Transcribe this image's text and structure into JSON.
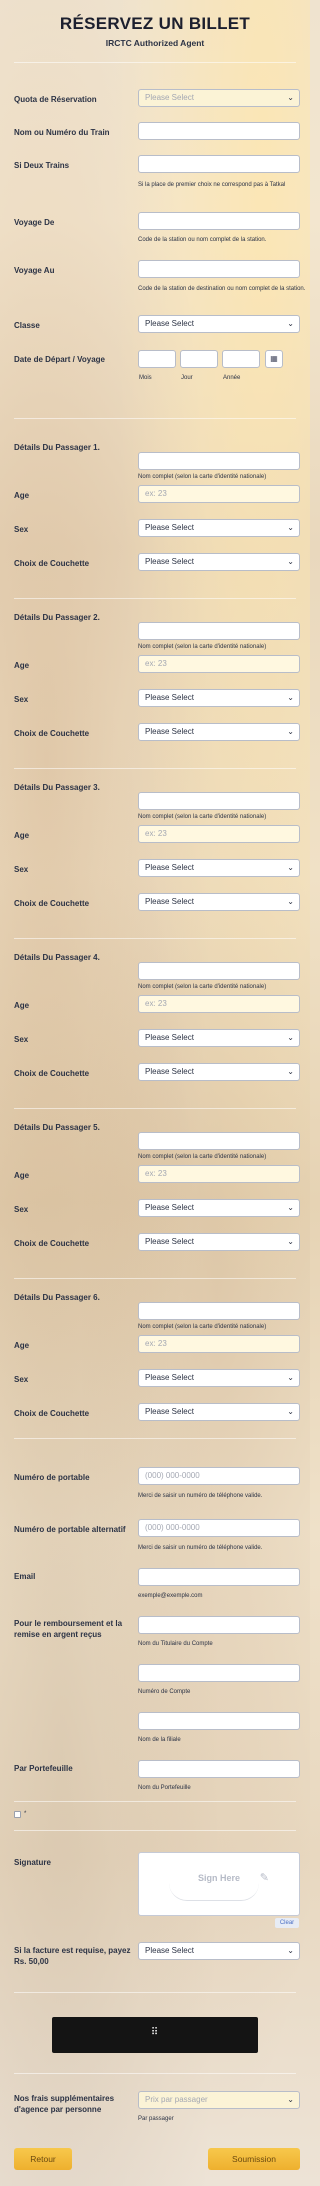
{
  "header": {
    "title": "RÉSERVEZ UN BILLET",
    "subtitle": "IRCTC Authorized Agent"
  },
  "fields": {
    "quota": {
      "label": "Quota de Réservation",
      "value": "Please Select"
    },
    "train": {
      "label": "Nom ou Numéro du Train"
    },
    "two_trains": {
      "label": "Si Deux Trains",
      "hint": "Si la place de premier choix ne correspond pas à Tatkal"
    },
    "from": {
      "label": "Voyage De",
      "hint": "Code de la station ou nom complet de la station."
    },
    "to": {
      "label": "Voyage Au",
      "hint": "Code de la station de destination ou nom complet de la station."
    },
    "class": {
      "label": "Classe",
      "value": "Please Select"
    },
    "date": {
      "label": "Date de Départ / Voyage",
      "month": "Mois",
      "day": "Jour",
      "year": "Année"
    }
  },
  "passengers": [
    {
      "title": "Détails Du Passager 1.",
      "name_hint": "Nom complet (selon la carte d'identité nationale)",
      "age_label": "Age",
      "age_ph": "ex: 23",
      "sex_label": "Sex",
      "sex_value": "Please Select",
      "berth_label": "Choix de Couchette",
      "berth_value": "Please Select"
    },
    {
      "title": "Détails Du Passager 2.",
      "name_hint": "Nom complet (selon la carte d'identité nationale)",
      "age_label": "Age",
      "age_ph": "ex: 23",
      "sex_label": "Sex",
      "sex_value": "Please Select",
      "berth_label": "Choix de Couchette",
      "berth_value": "Please Select"
    },
    {
      "title": "Détails Du Passager 3.",
      "name_hint": "Nom complet (selon la carte d'identité nationale)",
      "age_label": "Age",
      "age_ph": "ex: 23",
      "sex_label": "Sex",
      "sex_value": "Please Select",
      "berth_label": "Choix de Couchette",
      "berth_value": "Please Select"
    },
    {
      "title": "Détails Du Passager 4.",
      "name_hint": "Nom complet (selon la carte d'identité nationale)",
      "age_label": "Age",
      "age_ph": "ex: 23",
      "sex_label": "Sex",
      "sex_value": "Please Select",
      "berth_label": "Choix de Couchette",
      "berth_value": "Please Select"
    },
    {
      "title": "Détails Du Passager 5.",
      "name_hint": "Nom complet (selon la carte d'identité nationale)",
      "age_label": "Age",
      "age_ph": "ex: 23",
      "sex_label": "Sex",
      "sex_value": "Please Select",
      "berth_label": "Choix de Couchette",
      "berth_value": "Please Select"
    },
    {
      "title": "Détails Du Passager 6.",
      "name_hint": "Nom complet (selon la carte d'identité nationale)",
      "age_label": "Age",
      "age_ph": "ex: 23",
      "sex_label": "Sex",
      "sex_value": "Please Select",
      "berth_label": "Choix de Couchette",
      "berth_value": "Please Select"
    }
  ],
  "contact": {
    "mobile": {
      "label": "Numéro de portable",
      "placeholder": "(000) 000-0000",
      "hint": "Merci de saisir un numéro de téléphone valide."
    },
    "alt_mobile": {
      "label": "Numéro de portable alternatif",
      "placeholder": "(000) 000-0000",
      "hint": "Merci de saisir un numéro de téléphone valide."
    },
    "email": {
      "label": "Email",
      "hint": "exemple@exemple.com"
    },
    "refund": {
      "label": "Pour le remboursement et la remise en argent reçus",
      "holder_hint": "Nom du Titulaire du Compte",
      "account_hint": "Numéro de Compte",
      "branch_hint": "Nom de la filiale"
    },
    "wallet": {
      "label": "Par Portefeuille",
      "hint": "Nom du Portefeuille"
    }
  },
  "checkbox_label": "*",
  "signature": {
    "label": "Signature",
    "placeholder": "Sign Here",
    "clear": "Clear"
  },
  "invoice": {
    "label": "Si la facture est requise, payez Rs. 50,00",
    "value": "Please Select"
  },
  "captcha": {
    "text": "⠿"
  },
  "fees": {
    "label": "Nos frais supplémentaires d'agence par personne",
    "value": "Prix par passager",
    "hint": "Par passager"
  },
  "buttons": {
    "back": "Retour",
    "submit": "Soumission"
  }
}
